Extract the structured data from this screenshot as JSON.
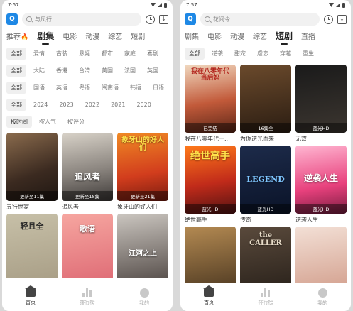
{
  "left": {
    "status_time": "7:57",
    "search_placeholder": "与凤行",
    "logo_glyph": "Q",
    "tabs": [
      "推荐",
      "剧集",
      "电影",
      "动漫",
      "综艺",
      "短剧"
    ],
    "active_tab": "剧集",
    "filter_rows": [
      [
        "全部",
        "爱情",
        "古装",
        "悬疑",
        "都市",
        "家庭",
        "喜剧"
      ],
      [
        "全部",
        "大陆",
        "香港",
        "台湾",
        "美国",
        "法国",
        "英国"
      ],
      [
        "全部",
        "国语",
        "英语",
        "粤语",
        "闽南语",
        "韩语",
        "日语"
      ],
      [
        "全部",
        "2024",
        "2023",
        "2022",
        "2021",
        "2020"
      ]
    ],
    "sort_options": [
      "按时间",
      "按人气",
      "按评分"
    ],
    "cards": [
      {
        "title": "五行世家",
        "caption": "更新至11集"
      },
      {
        "title": "追风者",
        "caption": "更新至18集",
        "poster_text": "追风者"
      },
      {
        "title": "象牙山的好人们",
        "caption": "更新至21集",
        "poster_text": "象牙山的好人们"
      },
      {
        "title": "",
        "caption": "",
        "poster_text": "轻且全"
      },
      {
        "title": "",
        "caption": "",
        "poster_text": "歌语"
      },
      {
        "title": "",
        "caption": "",
        "poster_text": "江河之上"
      }
    ],
    "nav": [
      {
        "label": "首页",
        "icon": "home-icon"
      },
      {
        "label": "排行榜",
        "icon": "rank-icon"
      },
      {
        "label": "我的",
        "icon": "profile-icon"
      }
    ]
  },
  "right": {
    "status_time": "7:57",
    "search_placeholder": "花间令",
    "logo_glyph": "Q",
    "tabs": [
      "剧集",
      "电影",
      "动漫",
      "综艺",
      "短剧",
      "直播"
    ],
    "active_tab": "短剧",
    "filter_row": [
      "全部",
      "逆袭",
      "甜宠",
      "虐恋",
      "穿越",
      "重生"
    ],
    "cards": [
      {
        "title": "我在八零年代一...",
        "caption": "已完结",
        "poster_text": "我在八零年代当后妈"
      },
      {
        "title": "为你逆光而来",
        "caption": "16集全"
      },
      {
        "title": "无双",
        "caption": "蓝光HD"
      },
      {
        "title": "绝世高手",
        "caption": "蓝光HD",
        "poster_text": "绝世高手"
      },
      {
        "title": "传奇",
        "caption": "蓝光HD",
        "poster_text": "LEGEND"
      },
      {
        "title": "逆袭人生",
        "caption": "蓝光HD",
        "poster_text": "逆袭人生"
      },
      {
        "title": "",
        "caption": ""
      },
      {
        "title": "",
        "caption": "",
        "poster_text": "the CALLER"
      },
      {
        "title": "",
        "caption": ""
      }
    ],
    "nav": [
      {
        "label": "首页",
        "icon": "home-icon"
      },
      {
        "label": "排行榜",
        "icon": "rank-icon"
      },
      {
        "label": "我的",
        "icon": "profile-icon"
      }
    ]
  },
  "colors": {
    "accent": "#1e88e5",
    "flame": "#ff6a00"
  }
}
